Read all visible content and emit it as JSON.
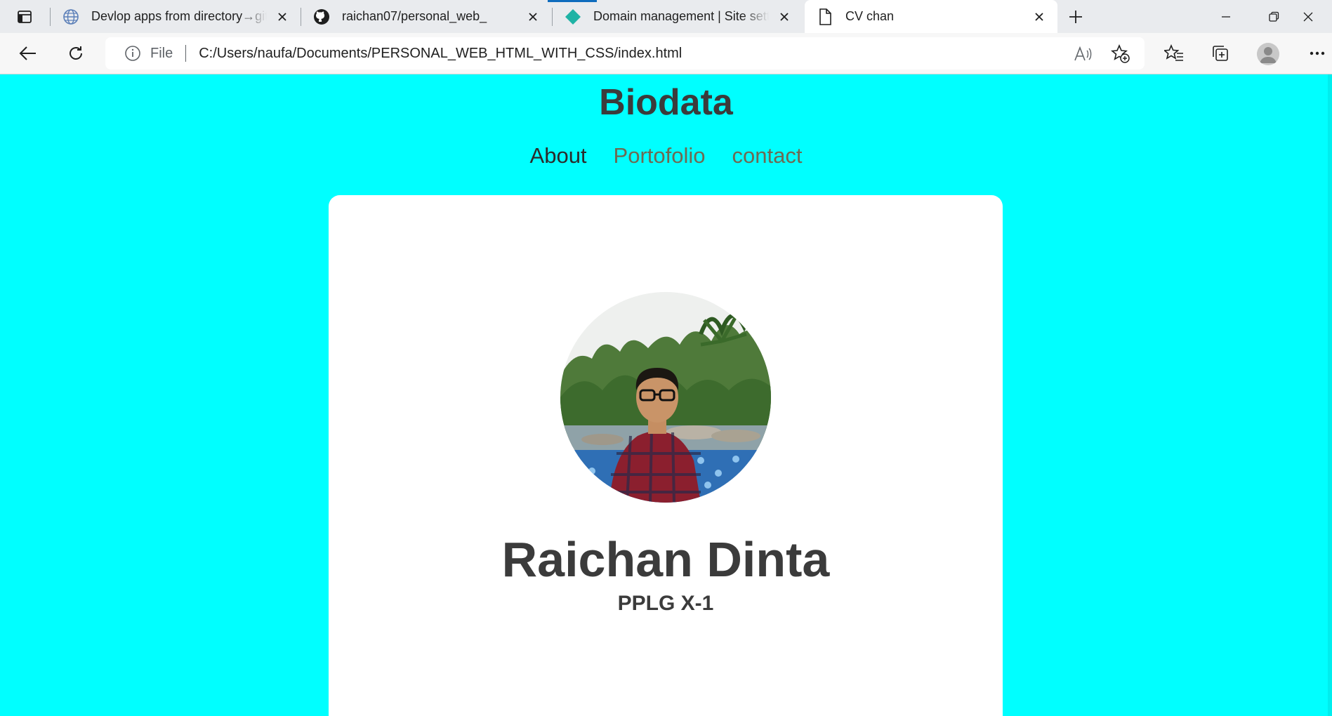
{
  "browser": {
    "tabs": [
      {
        "title": "Devlop apps from directory→gitl",
        "icon": "globe-icon",
        "active": false
      },
      {
        "title": "raichan07/personal_web_",
        "icon": "github-icon",
        "active": false
      },
      {
        "title": "Domain management | Site setti",
        "icon": "netlify-icon",
        "active": false
      },
      {
        "title": "CV chan",
        "icon": "file-icon",
        "active": true
      }
    ],
    "address": {
      "scheme_label": "File",
      "url": "C:/Users/naufa/Documents/PERSONAL_WEB_HTML_WITH_CSS/index.html"
    },
    "accent_color": "#0f6cbd"
  },
  "page": {
    "background_color": "#00FFFF",
    "title": "Biodata",
    "nav": {
      "about": "About",
      "portfolio": "Portofolio",
      "contact": "contact"
    },
    "profile": {
      "name": "Raichan Dinta",
      "class": "PPLG X-1"
    }
  }
}
